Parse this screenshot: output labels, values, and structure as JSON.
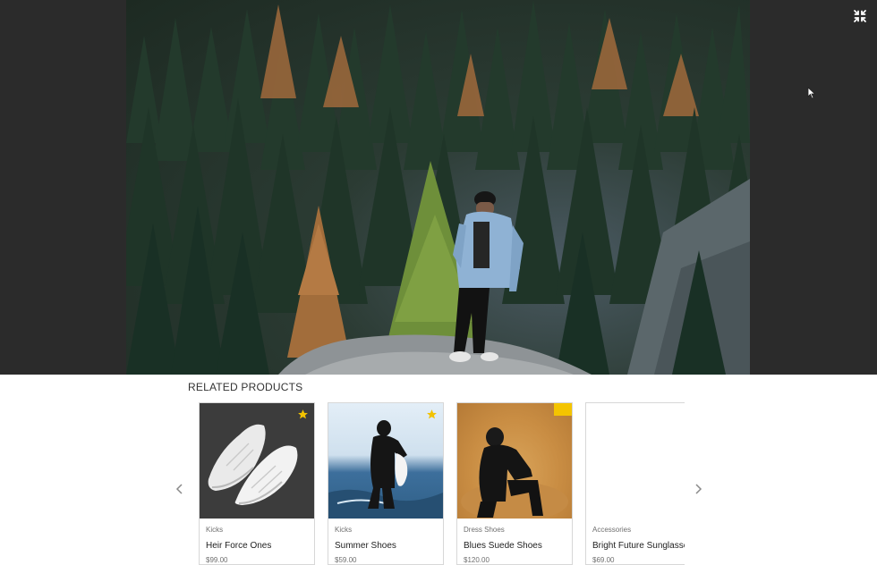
{
  "viewer": {
    "exit_fullscreen_icon": "compress-icon"
  },
  "related": {
    "title": "RELATED PRODUCTS",
    "prev_icon": "chevron-left-icon",
    "next_icon": "chevron-right-icon",
    "products": [
      {
        "category": "Kicks",
        "name": "Heir Force Ones",
        "price": "$99.00",
        "featured": true
      },
      {
        "category": "Kicks",
        "name": "Summer Shoes",
        "price": "$59.00",
        "featured": true
      },
      {
        "category": "Dress Shoes",
        "name": "Blues Suede Shoes",
        "price": "$120.00",
        "featured": false
      },
      {
        "category": "Accessories",
        "name": "Bright Future Sunglasses",
        "price": "$69.00",
        "featured": false
      }
    ]
  },
  "colors": {
    "lightbox_bg": "#2b2b2b",
    "star": "#f2c200"
  }
}
